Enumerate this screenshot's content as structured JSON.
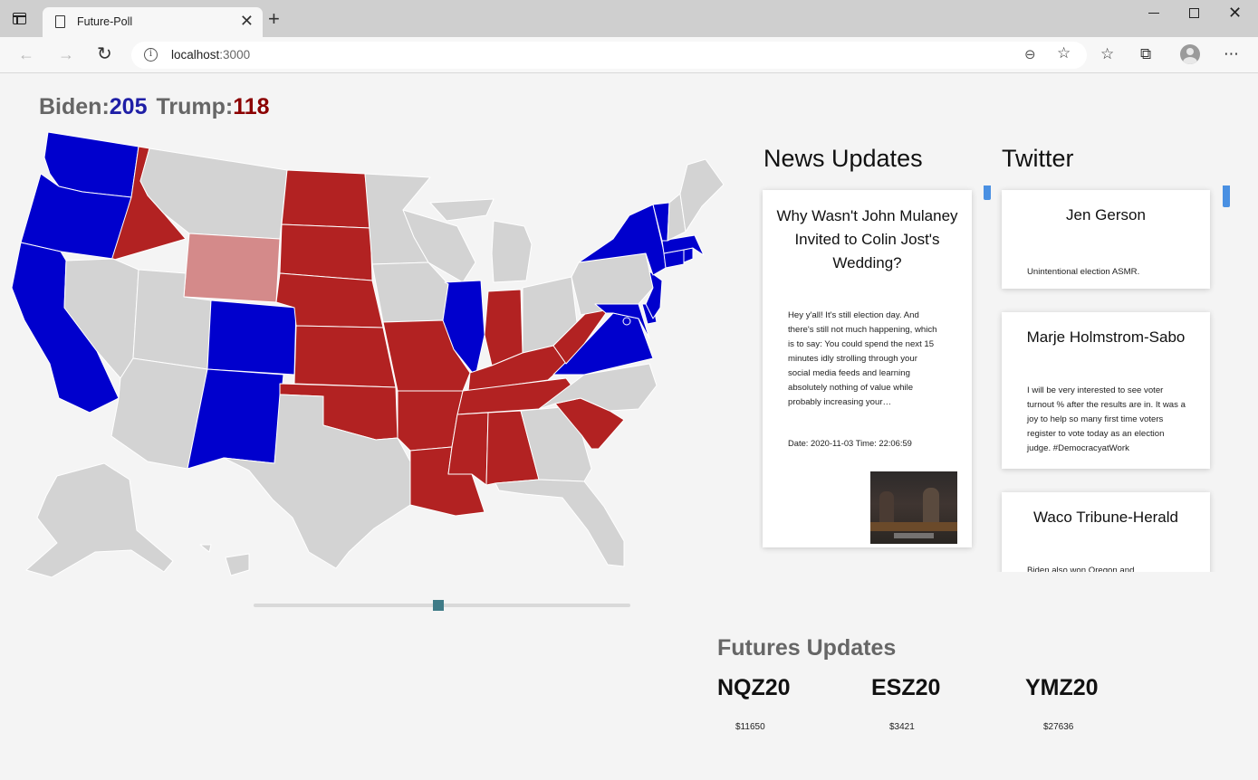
{
  "browser": {
    "tab_title": "Future-Poll",
    "new_tab_symbol": "+",
    "url_host": "localhost",
    "url_port": ":3000"
  },
  "score": {
    "biden_label": "Biden:",
    "biden_value": "205",
    "trump_label": "Trump:",
    "trump_value": "118"
  },
  "map": {
    "colors": {
      "democrat": "#0000cd",
      "republican": "#b22222",
      "leaning_republican": "#d48a8a",
      "undecided": "#d3d3d3"
    },
    "states": {
      "WA": "democrat",
      "OR": "democrat",
      "CA": "democrat",
      "CO": "democrat",
      "NM": "democrat",
      "IL": "democrat",
      "VA": "democrat",
      "NY": "democrat",
      "NJ": "democrat",
      "MD": "democrat",
      "DE": "democrat",
      "MA": "democrat",
      "CT": "democrat",
      "RI": "democrat",
      "VT": "democrat",
      "DC": "democrat",
      "ID": "republican",
      "ND": "republican",
      "SD": "republican",
      "NE": "republican",
      "KS": "republican",
      "OK": "republican",
      "MO": "republican",
      "AR": "republican",
      "LA": "republican",
      "MS": "republican",
      "AL": "republican",
      "TN": "republican",
      "KY": "republican",
      "IN": "republican",
      "WV": "republican",
      "SC": "republican",
      "WY": "leaning_republican"
    }
  },
  "timeline": {
    "position": 0.49
  },
  "news": {
    "heading": "News Updates",
    "items": [
      {
        "headline": "Why Wasn't John Mulaney Invited to Colin Jost's Wedding?",
        "body": "Hey y'all! It's still election day. And there's still not much happening, which is to say: You could spend the next 15 minutes idly strolling through your social media feeds and learning absolutely nothing of value while probably increasing your…",
        "date": "Date: 2020-11-03 Time: 22:06:59"
      }
    ]
  },
  "twitter": {
    "heading": "Twitter",
    "items": [
      {
        "name": "Jen Gerson",
        "text": "Unintentional election ASMR."
      },
      {
        "name": "Marje Holmstrom-Sabo",
        "text": "I will be very interested to see voter turnout % after the results are in. It was a joy to help so many first time voters register to vote today as an election judge. #DemocracyatWork"
      },
      {
        "name": "Waco Tribune-Herald",
        "text": "Biden also won Oregon and"
      }
    ]
  },
  "futures": {
    "heading": "Futures Updates",
    "items": [
      {
        "symbol": "NQZ20",
        "value": "$11650"
      },
      {
        "symbol": "ESZ20",
        "value": "$3421"
      },
      {
        "symbol": "YMZ20",
        "value": "$27636"
      }
    ]
  }
}
